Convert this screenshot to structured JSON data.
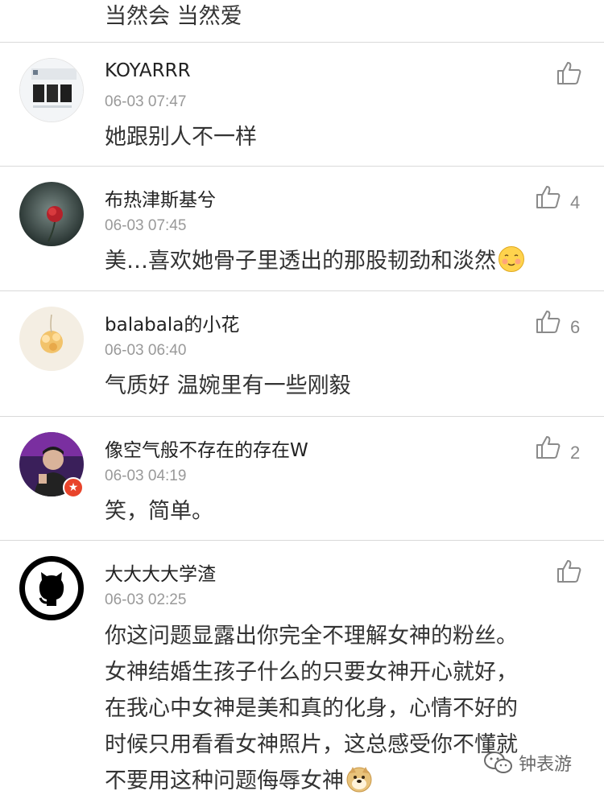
{
  "top_text": "当然会 当然爱",
  "comments": [
    {
      "username": "KOYARRR",
      "time": "06-03 07:47",
      "content": "她跟别人不一样",
      "likes": ""
    },
    {
      "username": "布热津斯基兮",
      "time": "06-03 07:45",
      "content": "美…喜欢她骨子里透出的那股韧劲和淡然",
      "likes": "4"
    },
    {
      "username": "balabala的小花",
      "time": "06-03 06:40",
      "content": "气质好 温婉里有一些刚毅",
      "likes": "6"
    },
    {
      "username": "像空气般不存在的存在W",
      "time": "06-03 04:19",
      "content": "笑，简单。",
      "likes": "2"
    },
    {
      "username": "大大大大学渣",
      "time": "06-03 02:25",
      "content": "你这问题显露出你完全不理解女神的粉丝。\n女神结婚生孩子什么的只要女神开心就好，\n在我心中女神是美和真的化身，心情不好的\n时候只用看看女神照片，这总感受你不懂就\n不要用这种问题侮辱女神",
      "likes": ""
    }
  ],
  "watermark": "钟表游",
  "icons": {
    "like": "thumbs-up-icon",
    "badge": "star-badge-icon",
    "emoji_smile": "blush-emoji-icon",
    "emoji_doge": "doge-emoji-icon",
    "watermark": "wechat-icon"
  }
}
